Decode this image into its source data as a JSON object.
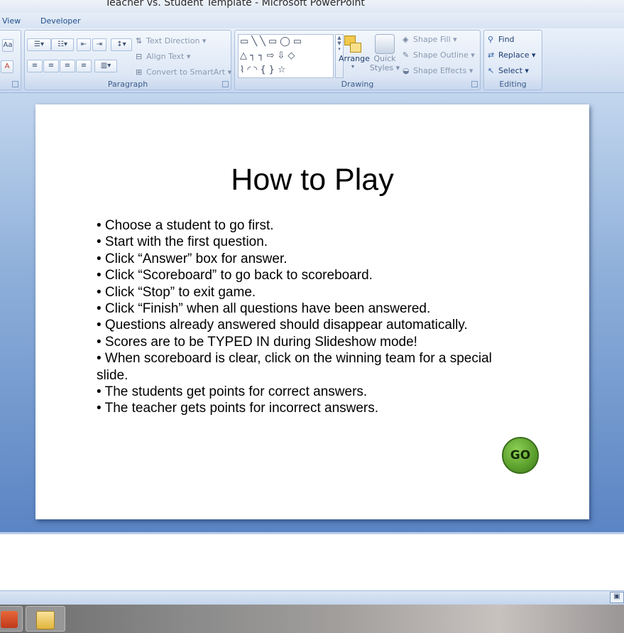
{
  "window": {
    "title": "Teacher vs. Student Template - Microsoft PowerPoint"
  },
  "ribbon_tabs": [
    {
      "label": "View"
    },
    {
      "label": "Developer"
    }
  ],
  "paragraph_group": {
    "name": "Paragraph",
    "text_direction": "Text Direction",
    "align_text": "Align Text",
    "convert_smartart": "Convert to SmartArt"
  },
  "drawing_group": {
    "name": "Drawing",
    "arrange": "Arrange",
    "quick_styles_line1": "Quick",
    "quick_styles_line2": "Styles",
    "shape_fill": "Shape Fill",
    "shape_outline": "Shape Outline",
    "shape_effects": "Shape Effects"
  },
  "editing_group": {
    "name": "Editing",
    "find": "Find",
    "replace": "Replace",
    "select": "Select"
  },
  "slide": {
    "title": "How to Play",
    "bullets": [
      "• Choose a student to go first.",
      "• Start with the first question.",
      "• Click “Answer” box for answer.",
      "• Click “Scoreboard” to go back to scoreboard.",
      "• Click “Stop” to exit game.",
      "• Click “Finish” when all questions have been answered.",
      "• Questions already answered should disappear automatically.",
      "• Scores are to be TYPED IN during Slideshow mode!",
      "• When scoreboard is clear, click on the winning team for a special slide.",
      "• The students get points for correct answers.",
      "• The teacher gets points for incorrect answers."
    ],
    "go_button": "GO"
  },
  "icons": [
    "bullets-icon",
    "numbering-icon",
    "decrease-indent-icon",
    "increase-indent-icon",
    "line-spacing-icon",
    "align-left-icon",
    "center-icon",
    "align-right-icon",
    "justify-icon",
    "columns-icon",
    "shapes-gallery-icon",
    "arrange-icon",
    "quick-styles-icon",
    "find-icon",
    "replace-icon",
    "select-icon"
  ],
  "colors": {
    "go_button": "#5a9e2c",
    "workspace": "#8fb0da",
    "ribbon": "#dde7f5"
  }
}
